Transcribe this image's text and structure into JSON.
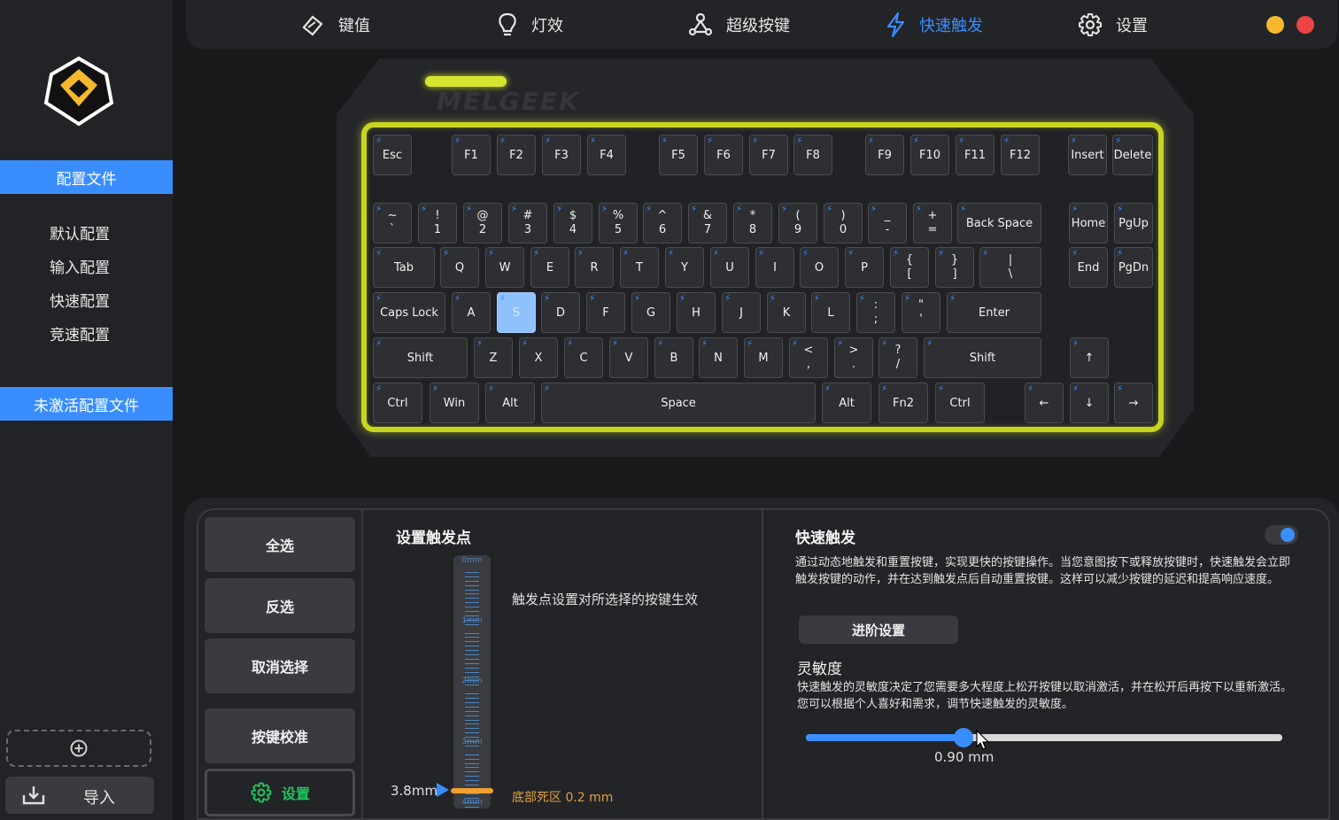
{
  "sidebar": {
    "profile_header": "配置文件",
    "profiles": [
      "默认配置",
      "输入配置",
      "快速配置",
      "竞速配置"
    ],
    "inactive_header": "未激活配置文件",
    "import_label": "导入"
  },
  "nav": {
    "items": [
      {
        "label": "键值",
        "icon": "keymap-icon"
      },
      {
        "label": "灯效",
        "icon": "lightbulb-icon"
      },
      {
        "label": "超级按键",
        "icon": "super-key-icon"
      },
      {
        "label": "快速触发",
        "icon": "lightning-icon",
        "active": true
      },
      {
        "label": "设置",
        "icon": "gear-icon"
      }
    ],
    "window_dots": [
      "#f5b82e",
      "#ef4444"
    ]
  },
  "keyboard": {
    "brand": "MELGEEK",
    "selected_key": "S"
  },
  "actions": {
    "select_all": "全选",
    "invert": "反选",
    "deselect": "取消选择",
    "calibrate": "按键校准",
    "settings": "设置"
  },
  "trigger": {
    "title": "设置触发点",
    "note": "触发点设置对所选择的按键生效",
    "value_label": "3.8mm",
    "deadzone_label": "底部死区 0.2 mm",
    "gauge_labels": [
      "0mm",
      "1mm",
      "2mm",
      "3mm",
      "4mm"
    ],
    "value_fraction": 0.95
  },
  "rapid": {
    "title": "快速触发",
    "enabled": true,
    "description": "通过动态地触发和重置按键，实现更快的按键操作。当您意图按下或释放按键时，快速触发会立即触发按键的动作，并在达到触发点后自动重置按键。这样可以减少按键的延迟和提高响应速度。",
    "advanced_label": "进阶设置",
    "sensitivity_title": "灵敏度",
    "sensitivity_desc": "快速触发的灵敏度决定了您需要多大程度上松开按键以取消激活，并在松开后再按下以重新激活。您可以根据个人喜好和需求，调节快速触发的灵敏度。",
    "sensitivity_value": "0.90 mm",
    "slider_fraction": 0.33
  },
  "colors": {
    "accent": "#3a8dff",
    "plate_glow": "#c8d420",
    "deadzone": "#e0a040",
    "settings_green": "#22c55e"
  }
}
